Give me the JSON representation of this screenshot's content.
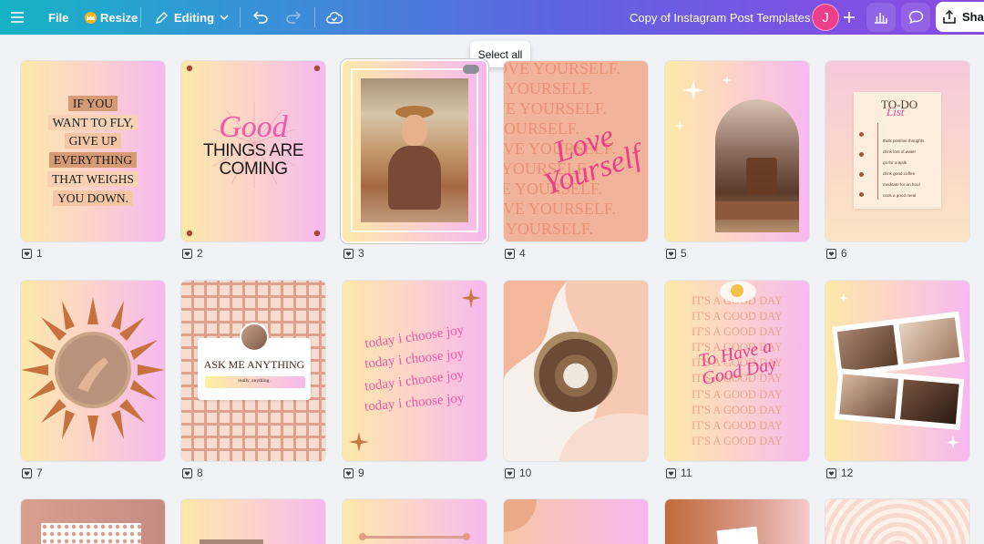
{
  "toolbar": {
    "file_label": "File",
    "resize_label": "Resize",
    "editing_label": "Editing",
    "doc_title": "Copy of Instagram Post Templates",
    "avatar_initial": "J",
    "share_label": "Shar"
  },
  "tooltip": "Select all",
  "pages": [
    {
      "number": "1"
    },
    {
      "number": "2"
    },
    {
      "number": "3"
    },
    {
      "number": "4"
    },
    {
      "number": "5"
    },
    {
      "number": "6"
    },
    {
      "number": "7"
    },
    {
      "number": "8"
    },
    {
      "number": "9"
    },
    {
      "number": "10"
    },
    {
      "number": "11"
    },
    {
      "number": "12"
    }
  ],
  "templates": {
    "t1": [
      "IF YOU",
      "WANT TO FLY,",
      "GIVE UP",
      "EVERYTHING",
      "THAT WEIGHS",
      "YOU DOWN."
    ],
    "t2": {
      "script": "Good",
      "line1": "THINGS ARE",
      "line2": "COMING"
    },
    "t4": {
      "bg_text": "LOVE YOURSELF.",
      "script": "Love Yourself"
    },
    "t6": {
      "title": "TO-DO",
      "script": "List",
      "items": [
        "think positive thoughts",
        "drink lots of water",
        "go for a walk",
        "drink good coffee",
        "meditate for an hour",
        "cook a good meal"
      ]
    },
    "t8": {
      "title": "ASK ME ANYTHING",
      "sub": "really, anything."
    },
    "t9": {
      "line": "today i choose joy"
    },
    "t11": {
      "line": "IT'S A GOOD DAY",
      "script": "To Have a Good Day"
    }
  },
  "colors": {
    "accent_pink": "#ec3f8a",
    "gradient_start": "#16b3c6",
    "gradient_end": "#8a4be3"
  }
}
